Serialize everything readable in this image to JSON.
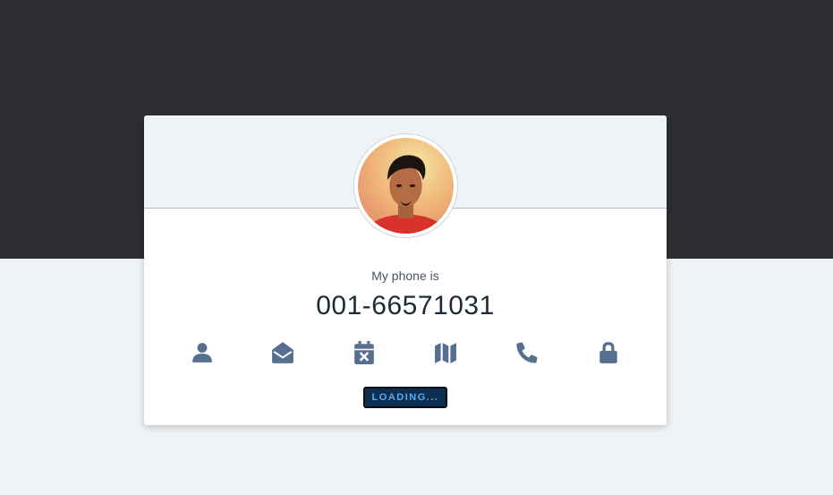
{
  "profile": {
    "label": "My phone is",
    "value": "001-66571031"
  },
  "icons": [
    {
      "name": "user-icon"
    },
    {
      "name": "envelope-open-icon"
    },
    {
      "name": "calendar-x-icon"
    },
    {
      "name": "map-icon"
    },
    {
      "name": "phone-icon"
    },
    {
      "name": "lock-icon"
    }
  ],
  "loading_label": "LOADING...",
  "colors": {
    "top_band": "#2c2e33",
    "page_background": "#eff3f6",
    "icon": "#566f8f",
    "loading_background": "#0e2f4f",
    "loading_text": "#5aa9f0"
  }
}
